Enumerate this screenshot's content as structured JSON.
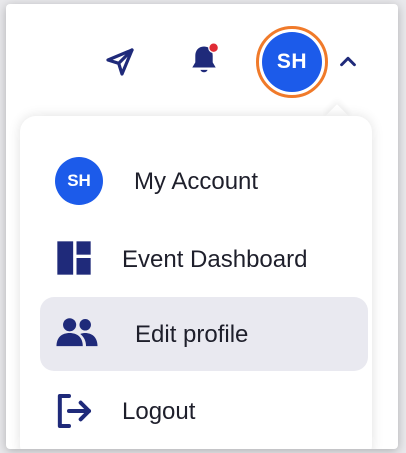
{
  "header": {
    "avatar_initials": "SH",
    "icons": {
      "send": "send-icon",
      "notifications": "bell-icon",
      "toggle": "chevron-up-icon"
    }
  },
  "menu": {
    "items": [
      {
        "label": "My Account",
        "icon": "avatar-icon",
        "initials": "SH"
      },
      {
        "label": "Event Dashboard",
        "icon": "dashboard-icon"
      },
      {
        "label": "Edit profile",
        "icon": "users-icon"
      },
      {
        "label": "Logout",
        "icon": "logout-icon"
      }
    ]
  },
  "colors": {
    "primary": "#1c5bea",
    "icon": "#1f2a7a",
    "notification_dot": "#e02b35",
    "avatar_ring": "#f07a2a",
    "active_item_bg": "#e9e9f0"
  }
}
